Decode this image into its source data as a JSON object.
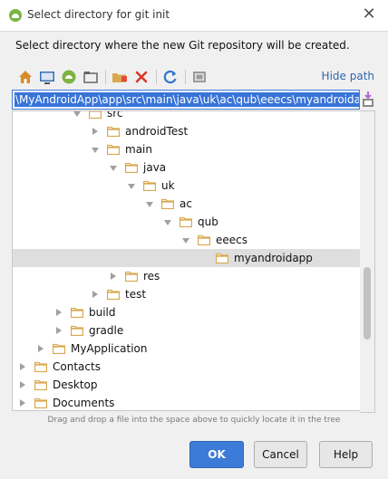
{
  "window": {
    "title": "Select directory for git init",
    "close_glyph": "✕",
    "app_icon": "android-studio-icon"
  },
  "description": "Select directory where the new Git repository will be created.",
  "toolbar": {
    "buttons": [
      {
        "name": "home-icon"
      },
      {
        "name": "desktop-icon"
      },
      {
        "name": "project-icon"
      },
      {
        "name": "module-icon"
      },
      {
        "name": "new-folder-icon"
      },
      {
        "name": "delete-icon"
      },
      {
        "name": "refresh-icon"
      },
      {
        "name": "show-hidden-icon"
      }
    ],
    "hide_path_label": "Hide path"
  },
  "path": {
    "value": "\\MyAndroidApp\\app\\src\\main\\java\\uk\\ac\\qub\\eeecs\\myandroidapp"
  },
  "tree": {
    "rows": [
      {
        "label": "src",
        "level": 6,
        "expanded": true,
        "selected": false
      },
      {
        "label": "androidTest",
        "level": 7,
        "expanded": false,
        "selected": false
      },
      {
        "label": "main",
        "level": 7,
        "expanded": true,
        "selected": false
      },
      {
        "label": "java",
        "level": 8,
        "expanded": true,
        "selected": false
      },
      {
        "label": "uk",
        "level": 9,
        "expanded": true,
        "selected": false
      },
      {
        "label": "ac",
        "level": 10,
        "expanded": true,
        "selected": false
      },
      {
        "label": "qub",
        "level": 11,
        "expanded": true,
        "selected": false
      },
      {
        "label": "eeecs",
        "level": 12,
        "expanded": true,
        "selected": false
      },
      {
        "label": "myandroidapp",
        "level": 13,
        "expanded": null,
        "selected": true
      },
      {
        "label": "res",
        "level": 8,
        "expanded": false,
        "selected": false
      },
      {
        "label": "test",
        "level": 7,
        "expanded": false,
        "selected": false
      },
      {
        "label": "build",
        "level": 5,
        "expanded": false,
        "selected": false
      },
      {
        "label": "gradle",
        "level": 5,
        "expanded": false,
        "selected": false
      },
      {
        "label": "MyApplication",
        "level": 4,
        "expanded": false,
        "selected": false
      },
      {
        "label": "Contacts",
        "level": 3,
        "expanded": false,
        "selected": false
      },
      {
        "label": "Desktop",
        "level": 3,
        "expanded": false,
        "selected": false
      },
      {
        "label": "Documents",
        "level": 3,
        "expanded": false,
        "selected": false
      }
    ]
  },
  "hint": "Drag and drop a file into the space above to quickly locate it in the tree",
  "buttons": {
    "ok": "OK",
    "cancel": "Cancel",
    "help": "Help"
  },
  "colors": {
    "accent": "#3d7bd8",
    "folder": "#d9a84e",
    "selection": "#dedede"
  }
}
